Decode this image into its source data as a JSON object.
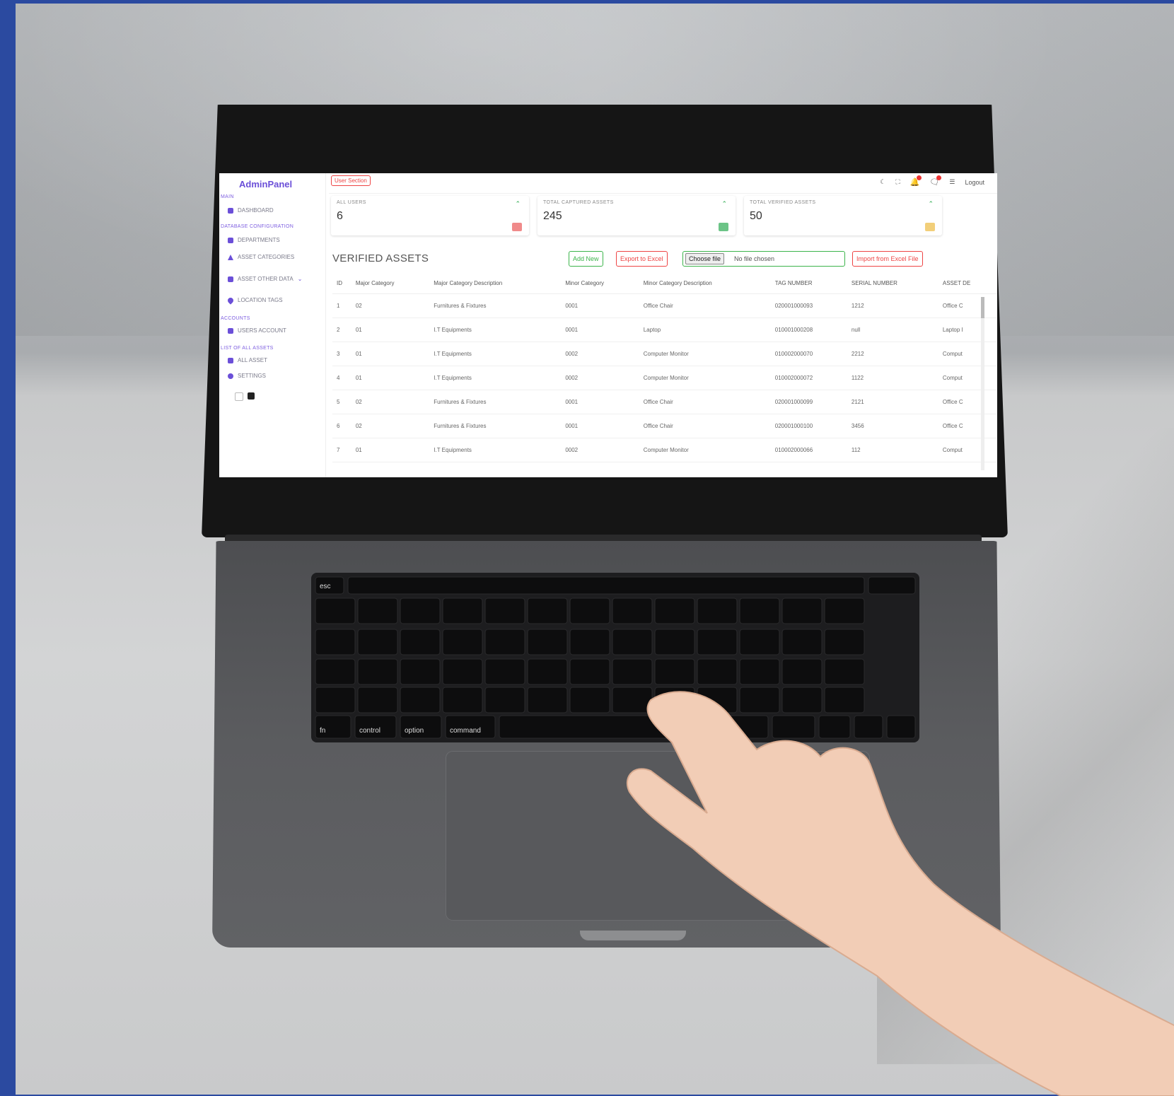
{
  "sidebar": {
    "brand": "AdminPanel",
    "sections": {
      "main": "MAIN",
      "database_config": "DATABASE CONFIGURATION",
      "accounts": "ACCOUNTS",
      "list_all_assets": "LIST OF ALL ASSETS"
    },
    "items": {
      "dashboard": "DASHBOARD",
      "departments": "DEPARTMENTS",
      "asset_categories": "ASSET CATEGORIES",
      "asset_other_data": "ASSET OTHER DATA",
      "location_tags": "LOCATION TAGS",
      "users_account": "USERS ACCOUNT",
      "all_asset": "ALL ASSET",
      "settings": "SETTINGS"
    }
  },
  "topbar": {
    "user_section": "User Section",
    "logout": "Logout"
  },
  "cards": [
    {
      "label": "ALL USERS",
      "value": "6",
      "badge_color": "#f08a8a"
    },
    {
      "label": "TOTAL CAPTURED ASSETS",
      "value": "245",
      "badge_color": "#6cc487"
    },
    {
      "label": "TOTAL VERIFIED ASSETS",
      "value": "50",
      "badge_color": "#f2cf7a"
    }
  ],
  "verified": {
    "title": "VERIFIED ASSETS",
    "add_new": "Add New",
    "export": "Export to Excel",
    "choose_file": "Choose file",
    "no_file": "No file chosen",
    "import": "Import from Excel File"
  },
  "table": {
    "headers": [
      "ID",
      "Major Category",
      "Major Category Description",
      "Minor Category",
      "Minor Category Description",
      "TAG NUMBER",
      "SERIAL NUMBER",
      "ASSET DE"
    ],
    "rows": [
      [
        "1",
        "02",
        "Furnitures & Fixtures",
        "0001",
        "Office Chair",
        "020001000093",
        "1212",
        "Office C"
      ],
      [
        "2",
        "01",
        "I.T Equipments",
        "0001",
        "Laptop",
        "010001000208",
        "null",
        "Laptop I"
      ],
      [
        "3",
        "01",
        "I.T Equipments",
        "0002",
        "Computer Monitor",
        "010002000070",
        "2212",
        "Comput"
      ],
      [
        "4",
        "01",
        "I.T Equipments",
        "0002",
        "Computer Monitor",
        "010002000072",
        "1122",
        "Comput"
      ],
      [
        "5",
        "02",
        "Furnitures & Fixtures",
        "0001",
        "Office Chair",
        "020001000099",
        "2121",
        "Office C"
      ],
      [
        "6",
        "02",
        "Furnitures & Fixtures",
        "0001",
        "Office Chair",
        "020001000100",
        "3456",
        "Office C"
      ],
      [
        "7",
        "01",
        "I.T Equipments",
        "0002",
        "Computer Monitor",
        "010002000066",
        "112",
        "Comput"
      ]
    ]
  },
  "keyboard": {
    "esc": "esc",
    "fn": "fn",
    "control": "control",
    "option": "option",
    "command": "command"
  },
  "colors": {
    "accent": "#6b4fd8",
    "danger": "#e44444",
    "success": "#3cb44b",
    "border_blue": "#2b4aa0"
  }
}
